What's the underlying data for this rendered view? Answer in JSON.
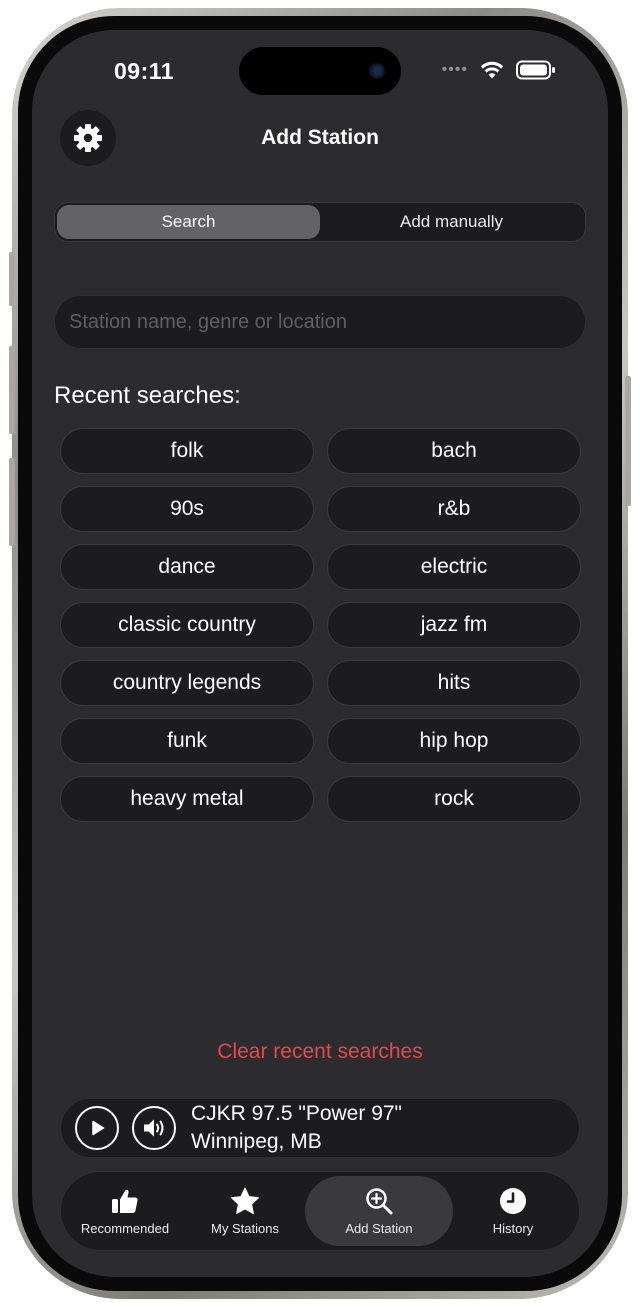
{
  "status_bar": {
    "time": "09:11"
  },
  "header": {
    "title": "Add Station",
    "settings_icon": "gear-icon"
  },
  "segments": [
    {
      "label": "Search",
      "active": true
    },
    {
      "label": "Add manually",
      "active": false
    }
  ],
  "search": {
    "value": "",
    "placeholder": "Station name, genre or location"
  },
  "recent": {
    "label": "Recent searches:",
    "items": [
      "folk",
      "bach",
      "90s",
      "r&b",
      "dance",
      "electric",
      "classic country",
      "jazz fm",
      "country legends",
      "hits",
      "funk",
      "hip hop",
      "heavy metal",
      "rock"
    ]
  },
  "clear_label": "Clear recent searches",
  "player": {
    "station_name": "CJKR 97.5 \"Power 97\"",
    "location": "Winnipeg, MB",
    "play_icon": "play-icon",
    "volume_icon": "speaker-icon"
  },
  "tabs": [
    {
      "label": "Recommended",
      "icon": "thumbs-up-icon",
      "active": false
    },
    {
      "label": "My Stations",
      "icon": "star-icon",
      "active": false
    },
    {
      "label": "Add Station",
      "icon": "magnifier-plus-icon",
      "active": true
    },
    {
      "label": "History",
      "icon": "clock-icon",
      "active": false
    }
  ],
  "colors": {
    "background": "#2c2c2e",
    "surface": "#1c1c1e",
    "selected_segment": "#636366",
    "destructive": "#e5484d"
  }
}
